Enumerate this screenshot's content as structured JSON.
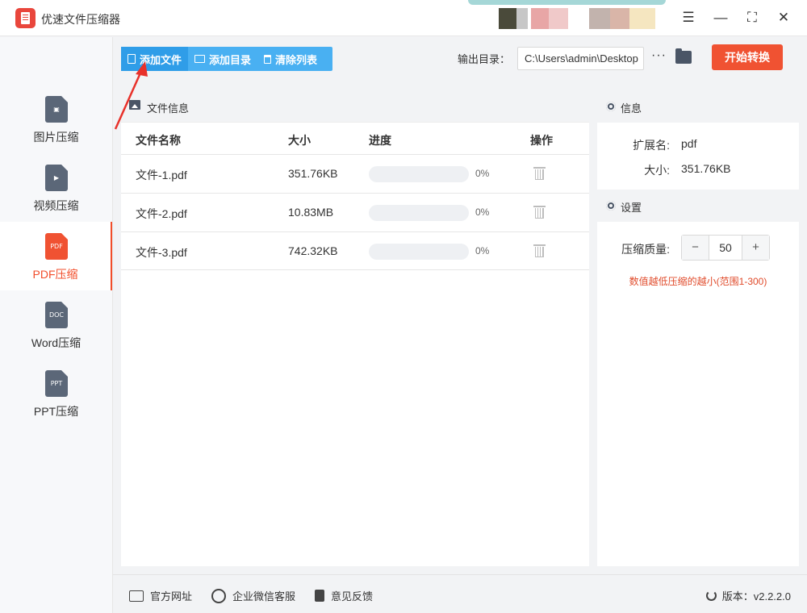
{
  "app": {
    "title": "优速文件压缩器"
  },
  "window": {
    "menu_icon": "☰",
    "minimize_icon": "—",
    "maximize_icon": "⛶",
    "close_icon": "✕"
  },
  "sidebar": {
    "items": [
      {
        "label": "图片压缩",
        "glyph": "▣",
        "active": false
      },
      {
        "label": "视频压缩",
        "glyph": "▶",
        "active": false
      },
      {
        "label": "PDF压缩",
        "glyph": "PDF",
        "active": true
      },
      {
        "label": "Word压缩",
        "glyph": "DOC",
        "active": false
      },
      {
        "label": "PPT压缩",
        "glyph": "PPT",
        "active": false
      }
    ]
  },
  "toolbar": {
    "add_file": "添加文件",
    "add_folder": "添加目录",
    "clear_list": "清除列表",
    "output_label": "输出目录：",
    "output_path": "C:\\Users\\admin\\Desktop",
    "more": "···",
    "start": "开始转换"
  },
  "file_panel": {
    "title": "文件信息",
    "columns": {
      "name": "文件名称",
      "size": "大小",
      "progress": "进度",
      "action": "操作"
    },
    "rows": [
      {
        "name": "文件-1.pdf",
        "size": "351.76KB",
        "progress": 0,
        "progress_text": "0%"
      },
      {
        "name": "文件-2.pdf",
        "size": "10.83MB",
        "progress": 0,
        "progress_text": "0%"
      },
      {
        "name": "文件-3.pdf",
        "size": "742.32KB",
        "progress": 0,
        "progress_text": "0%"
      }
    ]
  },
  "info_panel": {
    "title": "信息",
    "ext_label": "扩展名:",
    "ext_value": "pdf",
    "size_label": "大小:",
    "size_value": "351.76KB"
  },
  "settings_panel": {
    "title": "设置",
    "quality_label": "压缩质量:",
    "quality_value": "50",
    "minus": "−",
    "plus": "+",
    "hint": "数值越低压缩的越小(范围1-300)"
  },
  "footer": {
    "website": "官方网址",
    "wechat": "企业微信客服",
    "feedback": "意见反馈",
    "version": "版本：v2.2.2.0"
  },
  "colors": {
    "accent": "#f05232",
    "blue": "#49b0f2",
    "arrow": "#e8312a"
  }
}
